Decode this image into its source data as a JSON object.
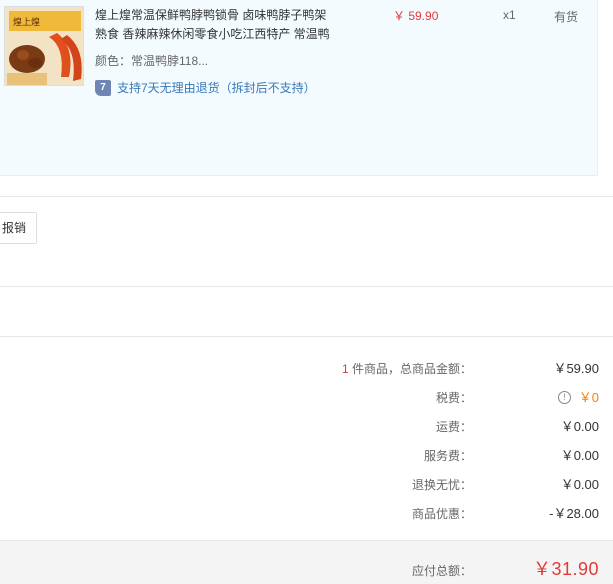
{
  "product": {
    "name": "煌上煌常温保鲜鸭脖鸭锁骨 卤味鸭脖子鸭架熟食 香辣麻辣休闲零食小吃江西特产 常温鸭",
    "color": "颜色：常温鸭脖118...",
    "return_icon": "7",
    "return_policy": "支持7天无理由退货（拆封后不支持）",
    "price": "￥ 59.90",
    "quantity": "x1",
    "stock": "有货",
    "thumb_brand": "煌上煌"
  },
  "invoice": {
    "button_label": "报销"
  },
  "summary": {
    "count": "1",
    "count_label": " 件商品，总商品金额：",
    "total_goods": "￥59.90",
    "tax_label": "税费：",
    "tax_value": "￥0",
    "tax_info_glyph": "!",
    "shipping_label": "运费：",
    "shipping_value": "￥0.00",
    "service_label": "服务费：",
    "service_value": "￥0.00",
    "return_label": "退换无忧：",
    "return_value": "￥0.00",
    "discount_label": "商品优惠：",
    "discount_value": "-￥28.00"
  },
  "total": {
    "label": "应付总额：",
    "value": "￥31.90"
  },
  "colors": {
    "price_red": "#e4393c",
    "tax_orange": "#ff7e00",
    "policy_blue": "#3a78b8",
    "product_bg": "#f3fbfe"
  }
}
